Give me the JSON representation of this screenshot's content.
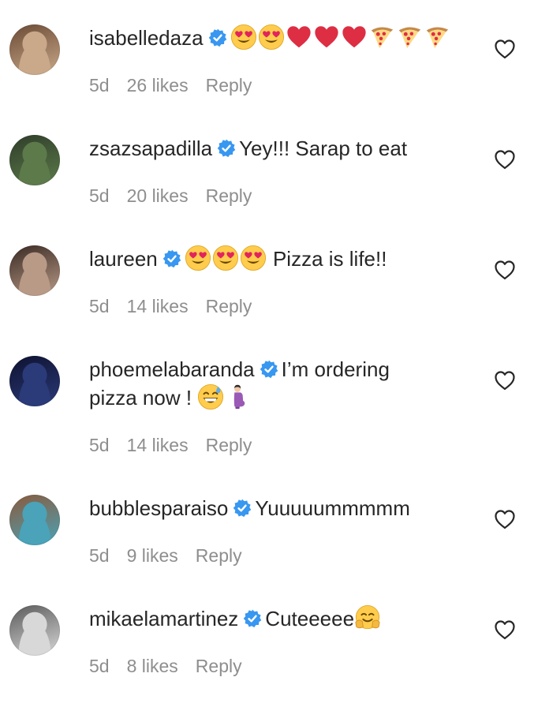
{
  "comments": [
    {
      "username": "isabelledaza",
      "text": "",
      "emojis": [
        "heart-eyes-emoji",
        "heart-eyes-emoji",
        "red-heart-emoji",
        "red-heart-emoji",
        "red-heart-emoji",
        "pizza-emoji",
        "pizza-emoji",
        "pizza-emoji"
      ],
      "time": "5d",
      "likes": "26 likes",
      "reply": "Reply",
      "avatar_colors": [
        "#c9a98a",
        "#6b4a35"
      ]
    },
    {
      "username": "zsazsapadilla",
      "text": "Yey!!! Sarap to eat",
      "emojis": [],
      "time": "5d",
      "likes": "20 likes",
      "reply": "Reply",
      "avatar_colors": [
        "#5c7a4a",
        "#2f3d2a"
      ]
    },
    {
      "username": "laureen",
      "text": "Pizza is life!!",
      "emojis": [
        "heart-eyes-emoji",
        "heart-eyes-emoji",
        "heart-eyes-emoji"
      ],
      "time": "5d",
      "likes": "14 likes",
      "reply": "Reply",
      "avatar_colors": [
        "#b89a86",
        "#3a2a24"
      ]
    },
    {
      "username": "phoemelabaranda",
      "text_line1": "I’m ordering",
      "text_line2": "pizza now !",
      "emojis_after": [
        "grinning-sweat-emoji",
        "pregnant-woman-emoji"
      ],
      "time": "5d",
      "likes": "14 likes",
      "reply": "Reply",
      "avatar_colors": [
        "#2b3a78",
        "#0e1230"
      ]
    },
    {
      "username": "bubblesparaiso",
      "text": "Yuuuuummmmm",
      "emojis": [],
      "time": "5d",
      "likes": "9 likes",
      "reply": "Reply",
      "avatar_colors": [
        "#4aa3b8",
        "#8a5a3c"
      ]
    },
    {
      "username": "mikaelamartinez",
      "text": "Cuteeeee",
      "emojis_after": [
        "hugging-face-emoji"
      ],
      "time": "5d",
      "likes": "8 likes",
      "reply": "Reply",
      "avatar_colors": [
        "#d8d8d8",
        "#5a5a5a"
      ]
    }
  ],
  "colors": {
    "verified": "#3897f0",
    "meta": "#8e8e8e",
    "text": "#262626"
  }
}
